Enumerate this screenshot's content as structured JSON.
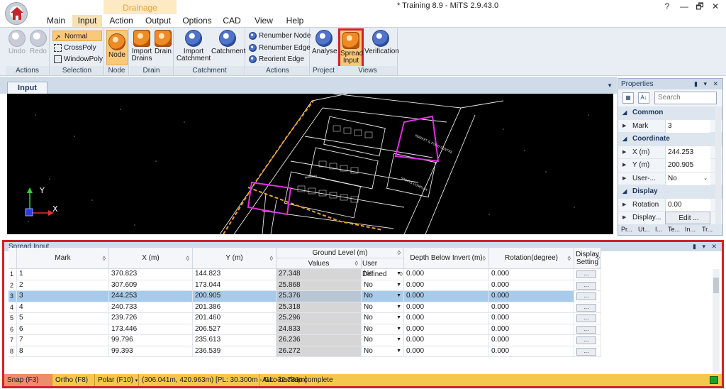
{
  "window": {
    "title": "* Training 8.9 - MiTS 2.9.43.0",
    "help_btn": "?",
    "minimize_btn": "—",
    "restore_btn": "🗗",
    "close_btn": "✕"
  },
  "ribbon_tabs": {
    "context_group": "Drainage",
    "main": "Main",
    "input": "Input",
    "action": "Action",
    "output": "Output",
    "options": "Options",
    "cad": "CAD",
    "view": "View",
    "help": "Help"
  },
  "ribbon": {
    "actions": {
      "label": "Actions",
      "undo": "Undo",
      "redo": "Redo"
    },
    "selection": {
      "label": "Selection",
      "normal": "Normal",
      "crosspoly": "CrossPoly",
      "windowpoly": "WindowPoly"
    },
    "node": {
      "label": "Node",
      "node": "Node"
    },
    "drain": {
      "label": "Drain",
      "import_drains": "Import Drains",
      "drain": "Drain"
    },
    "catchment": {
      "label": "Catchment",
      "import_catchment": "Import Catchment",
      "catchment": "Catchment"
    },
    "actions2": {
      "label": "Actions",
      "renumber_node": "Renumber Node",
      "renumber_edge": "Renumber Edge",
      "reorient_edge": "Reorient Edge"
    },
    "project": {
      "label": "Project",
      "analyse": "Analyse"
    },
    "views": {
      "label": "Views",
      "spread_input": "Spread Input",
      "verification": "Verification"
    }
  },
  "document": {
    "tab": "Input"
  },
  "cad": {
    "axis_y": "Y",
    "axis_x": "X",
    "labels": [
      "MARKET & FOOD CENTRE",
      "SPORTS COMPLEX",
      "PARKING"
    ]
  },
  "properties": {
    "title": "Properties",
    "search_placeholder": "Search",
    "common": "Common",
    "mark_label": "Mark",
    "mark_value": "3",
    "coordinate": "Coordinate",
    "x_label": "X (m)",
    "x_value": "244.253",
    "y_label": "Y (m)",
    "y_value": "200.905",
    "user_label": "User-...",
    "user_value": "No",
    "display": "Display",
    "rotation_label": "Rotation",
    "rotation_value": "0.00",
    "display_label": "Display...",
    "display_value": "Edit ...",
    "tabs": [
      "Pr...",
      "Ut...",
      "I...",
      "Te...",
      "In...",
      "Tr..."
    ]
  },
  "spread": {
    "title": "Spread Input",
    "headers": {
      "mark": "Mark",
      "x": "X (m)",
      "y": "Y (m)",
      "ground_level": "Ground Level (m)",
      "values": "Values",
      "user_defined": "User Defined",
      "depth": "Depth Below Invert (m)",
      "rotation": "Rotation(degree)",
      "display_setting": "Display Setting"
    },
    "sort_glyph": "◊",
    "ellipsis": "...",
    "rows": [
      {
        "n": "1",
        "mark": "1",
        "x": "370.823",
        "y": "144.823",
        "gl": "27.348",
        "ud": "No",
        "depth": "0.000",
        "rot": "0.000"
      },
      {
        "n": "2",
        "mark": "2",
        "x": "307.609",
        "y": "173.044",
        "gl": "25.868",
        "ud": "No",
        "depth": "0.000",
        "rot": "0.000"
      },
      {
        "n": "3",
        "mark": "3",
        "x": "244.253",
        "y": "200.905",
        "gl": "25.376",
        "ud": "No",
        "depth": "0.000",
        "rot": "0.000"
      },
      {
        "n": "4",
        "mark": "4",
        "x": "240.733",
        "y": "201.386",
        "gl": "25.318",
        "ud": "No",
        "depth": "0.000",
        "rot": "0.000"
      },
      {
        "n": "5",
        "mark": "5",
        "x": "239.726",
        "y": "201.460",
        "gl": "25.296",
        "ud": "No",
        "depth": "0.000",
        "rot": "0.000"
      },
      {
        "n": "6",
        "mark": "6",
        "x": "173.446",
        "y": "206.527",
        "gl": "24.833",
        "ud": "No",
        "depth": "0.000",
        "rot": "0.000"
      },
      {
        "n": "7",
        "mark": "7",
        "x": "99.796",
        "y": "235.613",
        "gl": "26.236",
        "ud": "No",
        "depth": "0.000",
        "rot": "0.000"
      },
      {
        "n": "8",
        "mark": "8",
        "x": "99.393",
        "y": "236.539",
        "gl": "26.272",
        "ud": "No",
        "depth": "0.000",
        "rot": "0.000"
      }
    ],
    "selected_row": 2
  },
  "status": {
    "snap": "Snap (F3)",
    "ortho": "Ortho (F8)",
    "polar": "Polar (F10)",
    "coords": "(306.041m, 420.963m) [PL: 30.300m - GL: 32.736m]",
    "message": "Auto-backup complete"
  }
}
